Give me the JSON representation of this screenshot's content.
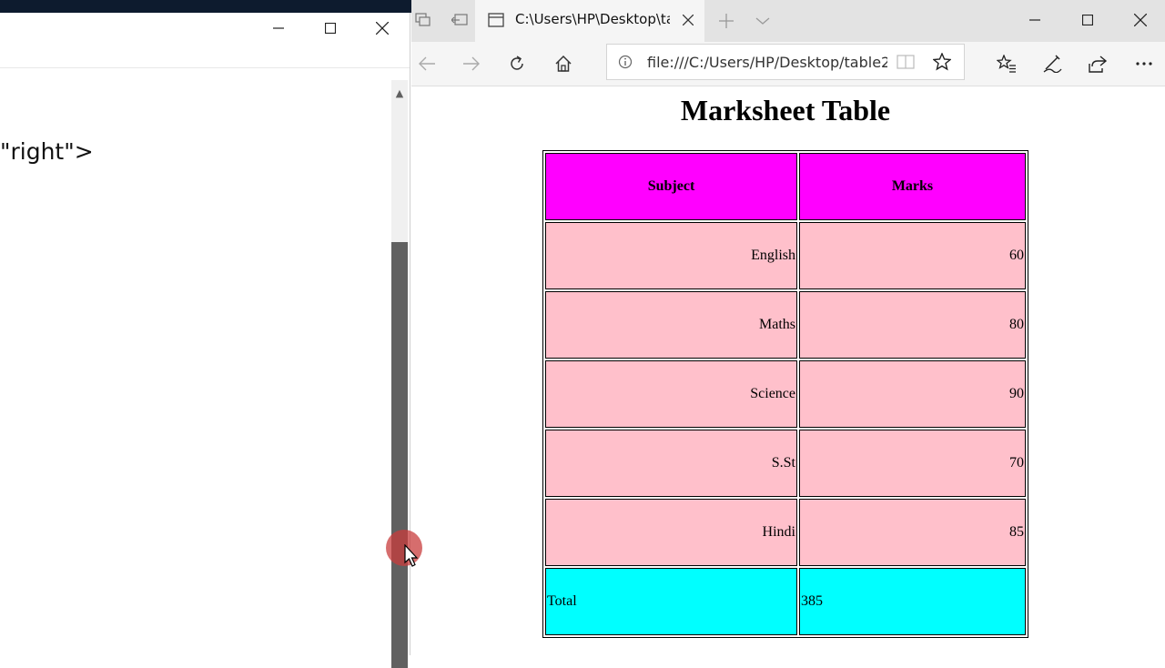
{
  "notepad": {
    "code_line": "\"right\">",
    "buttons": {
      "minimize": "minimize",
      "maximize": "maximize",
      "close": "close"
    }
  },
  "browser": {
    "tab_title": "C:\\Users\\HP\\Desktop\\ta",
    "address": "file:///C:/Users/HP/Desktop/table2.h",
    "icons": [
      "tab-preview-icon",
      "set-aside-icon",
      "page-icon",
      "tab-close-icon",
      "new-tab-icon",
      "tab-list-icon",
      "back-icon",
      "forward-icon",
      "refresh-icon",
      "home-icon",
      "info-icon",
      "reading-view-icon",
      "favorite-star-icon",
      "favorites-list-icon",
      "pen-icon",
      "share-icon",
      "more-icon"
    ]
  },
  "page": {
    "title": "Marksheet Table",
    "table": {
      "headers": [
        "Subject",
        "Marks"
      ],
      "rows": [
        {
          "subject": "English",
          "marks": "60"
        },
        {
          "subject": "Maths",
          "marks": "80"
        },
        {
          "subject": "Science",
          "marks": "90"
        },
        {
          "subject": "S.St",
          "marks": "70"
        },
        {
          "subject": "Hindi",
          "marks": "85"
        }
      ],
      "total": {
        "label": "Total",
        "value": "385"
      }
    }
  },
  "colors": {
    "header_bg": "#ff00ff",
    "row_bg": "#ffc0cb",
    "total_bg": "#00ffff",
    "scroll_thumb": "#606060"
  }
}
